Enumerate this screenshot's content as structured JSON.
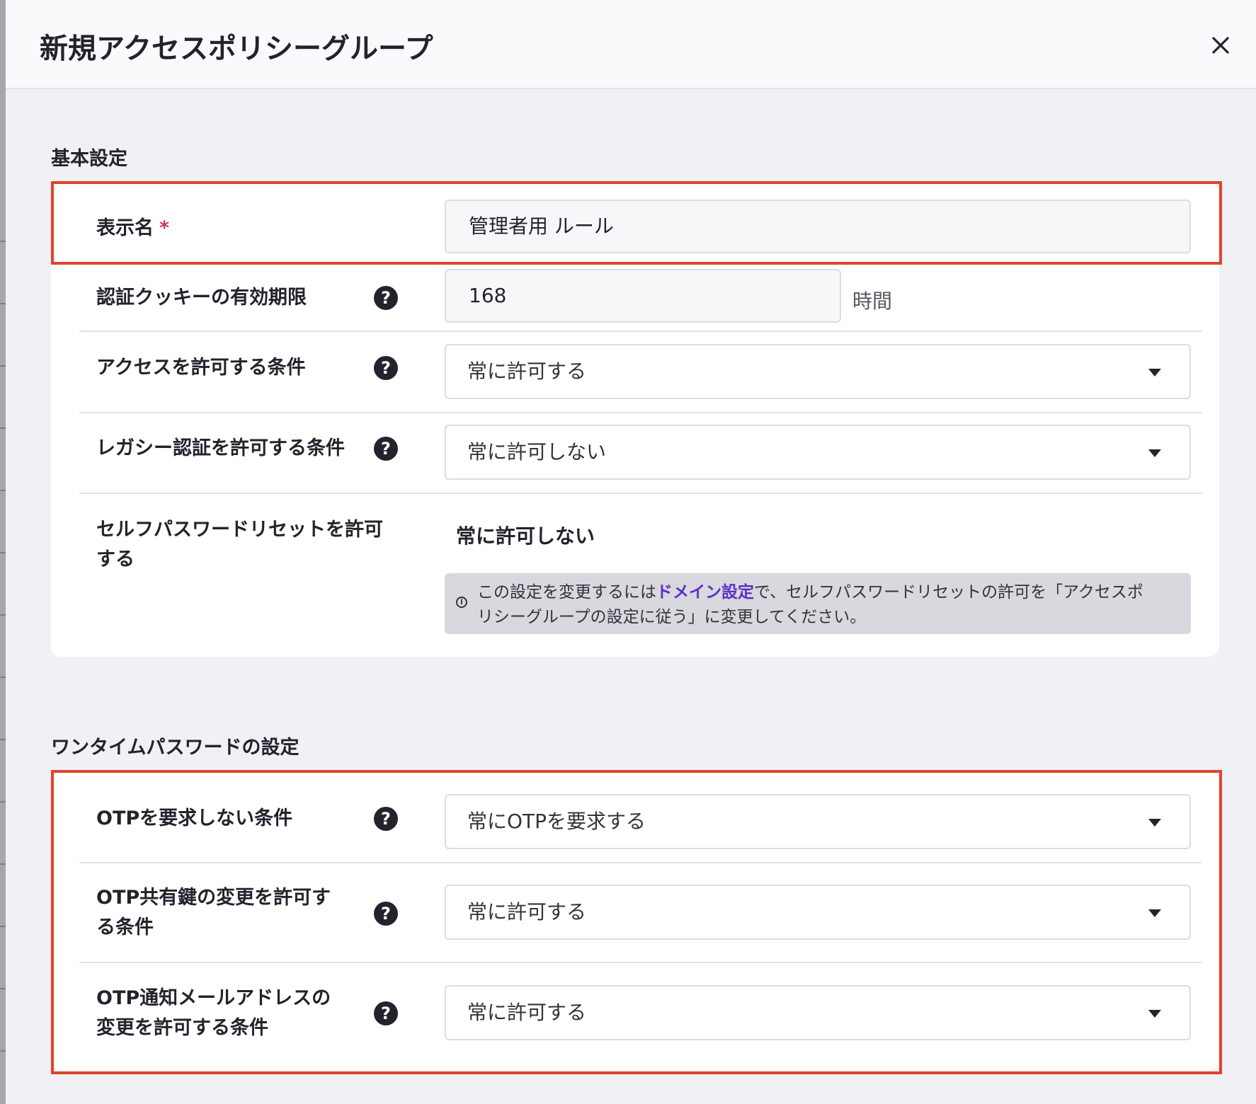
{
  "dialog": {
    "title": "新規アクセスポリシーグループ",
    "close_icon": "close-icon"
  },
  "basic": {
    "section_title": "基本設定",
    "display_name": {
      "label": "表示名",
      "required_mark": "*",
      "value": "管理者用 ルール"
    },
    "cookie_expiry": {
      "label": "認証クッキーの有効期限",
      "value": "168",
      "unit": "時間"
    },
    "access_condition": {
      "label": "アクセスを許可する条件",
      "selected": "常に許可する"
    },
    "legacy_auth": {
      "label": "レガシー認証を許可する条件",
      "selected": "常に許可しない"
    },
    "self_password_reset": {
      "label_line1": "セルフパスワードリセットを許可",
      "label_line2": "する",
      "value": "常に許可しない",
      "info": {
        "prefix": "この設定を変更するには",
        "link": "ドメイン設定",
        "suffix_line1": "で、セルフパスワードリセットの許可を「アクセスポ",
        "line2": "リシーグループの設定に従う」に変更してください。"
      }
    }
  },
  "otp": {
    "section_title": "ワンタイムパスワードの設定",
    "not_required": {
      "label": "OTPを要求しない条件",
      "selected": "常にOTPを要求する"
    },
    "shared_key_change": {
      "label_line1": "OTP共有鍵の変更を許可す",
      "label_line2": "る条件",
      "selected": "常に許可する"
    },
    "email_change": {
      "label_line1": "OTP通知メールアドレスの",
      "label_line2": "変更を許可する条件",
      "selected": "常に許可する"
    }
  },
  "colors": {
    "highlight": "#e0442a",
    "link": "#5b2fc9",
    "required": "#d2354a"
  }
}
